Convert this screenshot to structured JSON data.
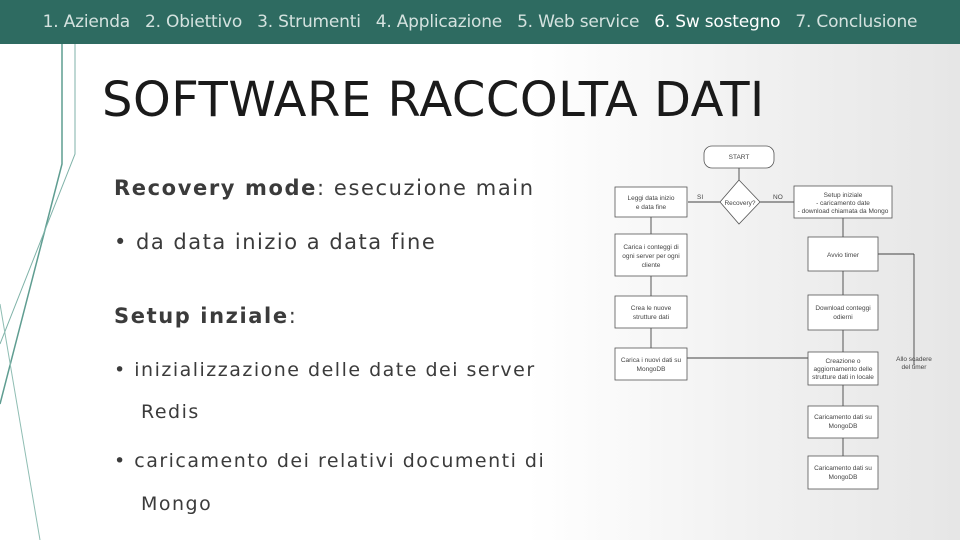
{
  "nav": {
    "items": [
      {
        "label": "1. Azienda"
      },
      {
        "label": "2. Obiettivo"
      },
      {
        "label": "3. Strumenti"
      },
      {
        "label": "4. Applicazione"
      },
      {
        "label": "5. Web service"
      },
      {
        "label": "6. Sw sostegno",
        "active": true
      },
      {
        "label": "7. Conclusione"
      }
    ]
  },
  "slide": {
    "title": "SOFTWARE RACCOLTA DATI",
    "recovery_label": "Recovery mode",
    "recovery_text": ": esecuzione main",
    "recovery_bullet": "• da data inizio a data fine",
    "setup_label": "Setup inziale",
    "setup_colon": ":",
    "bullet1_line1": "• inizializzazione delle date dei server",
    "bullet1_line2": "Redis",
    "bullet2_line1": "• caricamento dei relativi documenti di",
    "bullet2_line2": "Mongo"
  },
  "flowchart": {
    "start": "START",
    "decision": "Recovery?",
    "yes": "SI",
    "no": "NO",
    "left_1": [
      "Leggi data inizio",
      "e data fine"
    ],
    "left_2": [
      "Carica i conteggi di",
      "ogni server per ogni",
      "cliente"
    ],
    "left_3": [
      "Crea le nuove",
      "strutture dati"
    ],
    "left_4": [
      "Carica i nuovi dati su",
      "MongoDB"
    ],
    "right_1": [
      "Setup iniziale",
      "- caricamento date",
      "- download chiamata da Mongo"
    ],
    "right_2": [
      "Avvio timer"
    ],
    "right_3": [
      "Download conteggi",
      "odierni"
    ],
    "right_4": [
      "Creazione o",
      "aggiornamento delle",
      "strutture dati in locale"
    ],
    "timer_note": [
      "Allo scadere",
      "del timer"
    ],
    "right_5": [
      "Caricamento dati su",
      "MongoDB"
    ],
    "right_6": [
      "Caricamento dati su",
      "MongoDB"
    ]
  }
}
